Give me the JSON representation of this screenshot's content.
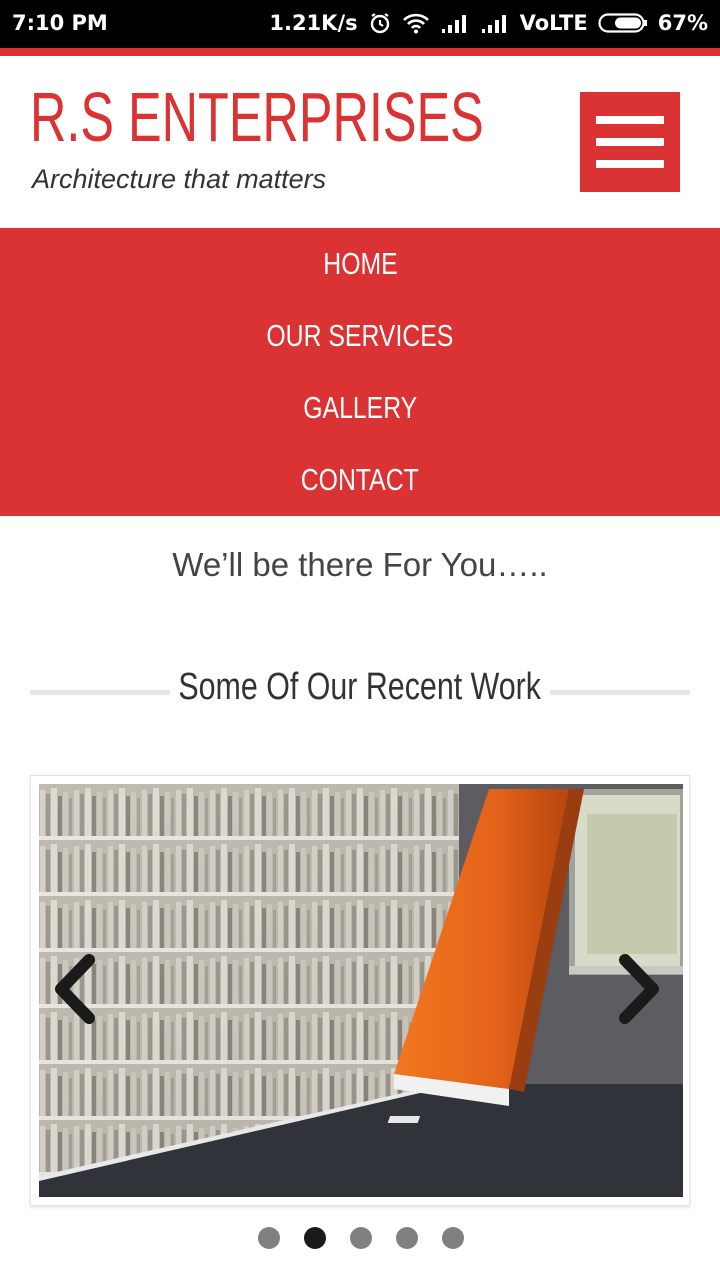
{
  "status_bar": {
    "time": "7:10 PM",
    "network_speed": "1.21K/s",
    "network_type": "VoLTE",
    "battery": "67%",
    "icons": [
      "alarm-icon",
      "wifi-icon",
      "signal-icon",
      "signal-icon",
      "battery-icon"
    ]
  },
  "header": {
    "site_title": "R.S ENTERPRISES",
    "tagline": "Architecture that matters",
    "menu_icon": "hamburger-menu-icon"
  },
  "nav": {
    "items": [
      {
        "label": "HOME"
      },
      {
        "label": "OUR SERVICES"
      },
      {
        "label": "GALLERY"
      },
      {
        "label": "CONTACT"
      }
    ]
  },
  "main": {
    "intro": "We’ll be there For You…..",
    "section_heading": "Some Of Our Recent Work"
  },
  "carousel": {
    "prev_icon": "chevron-left-icon",
    "next_icon": "chevron-right-icon",
    "dot_count": 5,
    "active_index": 1
  },
  "colors": {
    "brand_red": "#db3233",
    "text_dark": "#333333",
    "dot_active": "#1a1a1a",
    "dot_inactive": "#808080"
  }
}
